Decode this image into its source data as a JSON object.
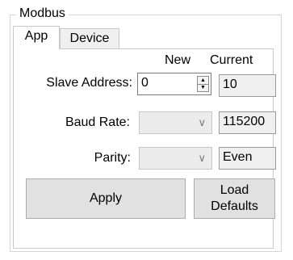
{
  "groupbox": {
    "title": "Modbus"
  },
  "tabs": [
    {
      "label": "App"
    },
    {
      "label": "Device"
    }
  ],
  "columns": {
    "new": "New",
    "current": "Current"
  },
  "fields": {
    "slave_address": {
      "label": "Slave Address:",
      "new_value": "0",
      "current_value": "10"
    },
    "baud_rate": {
      "label": "Baud Rate:",
      "new_value": "",
      "current_value": "115200"
    },
    "parity": {
      "label": "Parity:",
      "new_value": "",
      "current_value": "Even"
    }
  },
  "buttons": {
    "apply": "Apply",
    "load_defaults_line1": "Load",
    "load_defaults_line2": "Defaults"
  },
  "icons": {
    "spin_up": "spin-up-arrow-icon",
    "spin_down": "spin-down-arrow-icon",
    "dropdown": "chevron-down-icon"
  }
}
